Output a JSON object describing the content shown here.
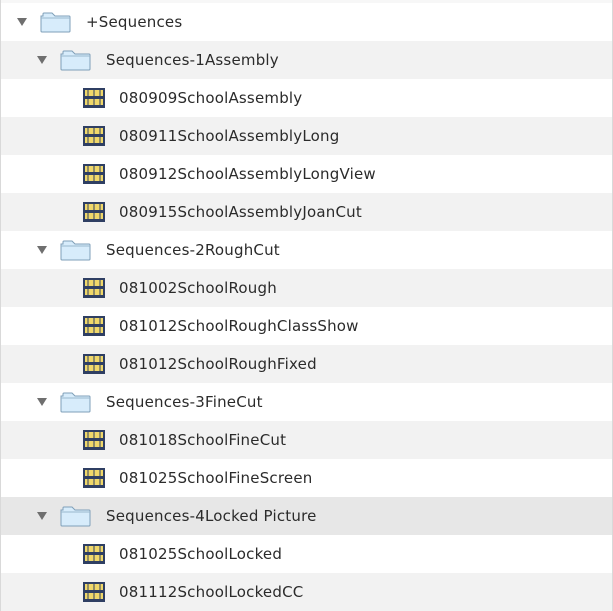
{
  "tree": {
    "root": {
      "label": "+Sequences",
      "expanded": true,
      "icon": "folder-icon"
    },
    "bins": [
      {
        "label": "Sequences-1Assembly",
        "expanded": true,
        "icon": "folder-icon",
        "items": [
          {
            "label": "080909SchoolAssembly",
            "icon": "sequence-icon"
          },
          {
            "label": "080911SchoolAssemblyLong",
            "icon": "sequence-icon"
          },
          {
            "label": "080912SchoolAssemblyLongView",
            "icon": "sequence-icon"
          },
          {
            "label": "080915SchoolAssemblyJoanCut",
            "icon": "sequence-icon"
          }
        ]
      },
      {
        "label": "Sequences-2RoughCut",
        "expanded": true,
        "icon": "folder-icon",
        "items": [
          {
            "label": "081002SchoolRough",
            "icon": "sequence-icon"
          },
          {
            "label": "081012SchoolRoughClassShow",
            "icon": "sequence-icon"
          },
          {
            "label": "081012SchoolRoughFixed",
            "icon": "sequence-icon"
          }
        ]
      },
      {
        "label": "Sequences-3FineCut",
        "expanded": true,
        "icon": "folder-icon",
        "items": [
          {
            "label": "081018SchoolFineCut",
            "icon": "sequence-icon"
          },
          {
            "label": "081025SchoolFineScreen",
            "icon": "sequence-icon"
          }
        ]
      },
      {
        "label": "Sequences-4Locked Picture",
        "expanded": true,
        "selected": true,
        "icon": "folder-icon",
        "items": [
          {
            "label": "081025SchoolLocked",
            "icon": "sequence-icon"
          },
          {
            "label": "081112SchoolLockedCC",
            "icon": "sequence-icon"
          }
        ]
      }
    ]
  },
  "colors": {
    "folder_fill": "#d7ecfb",
    "folder_stroke": "#7f9fb8",
    "sequence_frame": "#2f3f63",
    "sequence_panel": "#f0d86a",
    "disclosure": "#6f6f6f"
  }
}
